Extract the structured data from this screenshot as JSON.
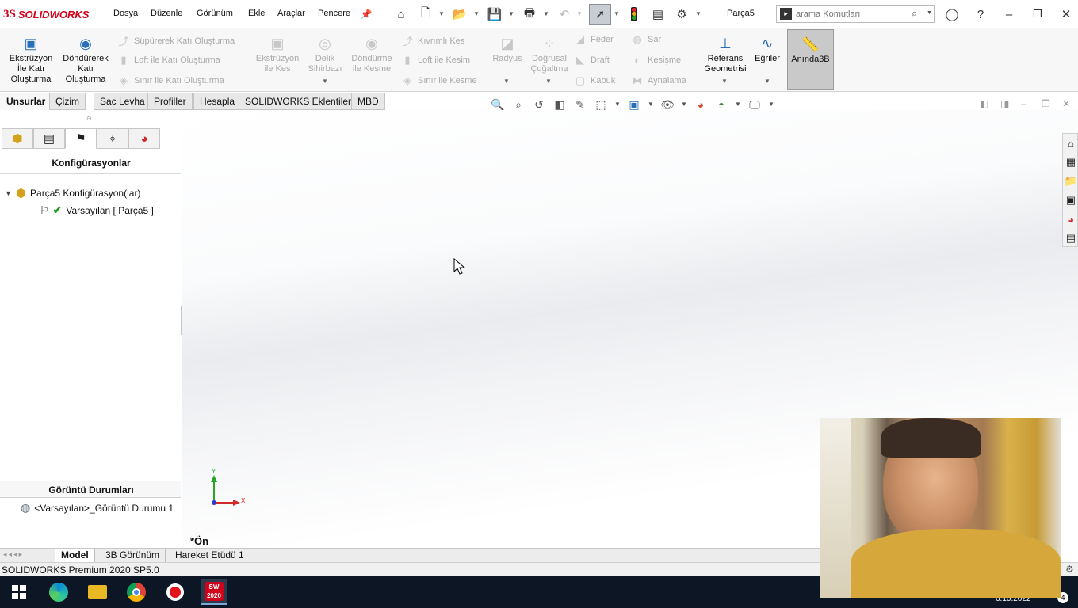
{
  "app": {
    "brand_prefix": "3S",
    "brand": "SOLIDWORKS",
    "doc_title": "Parça5"
  },
  "menu": [
    "Dosya",
    "Düzenle",
    "Görünüm",
    "Ekle",
    "Araçlar",
    "Pencere"
  ],
  "search": {
    "placeholder": "arama Komutları"
  },
  "ribbon": {
    "big_buttons": [
      {
        "label": "Ekstrüzyon İle Katı Oluşturma",
        "icon": "extrude-boss-icon",
        "enabled": true
      },
      {
        "label": "Döndürerek Katı Oluşturma",
        "icon": "revolve-boss-icon",
        "enabled": true
      },
      {
        "label": "Ekstrüzyon ile Kes",
        "icon": "extruded-cut-icon",
        "enabled": false
      },
      {
        "label": "Delik Sihirbazı",
        "icon": "hole-wizard-icon",
        "enabled": false
      },
      {
        "label": "Döndürme ile Kesme",
        "icon": "revolved-cut-icon",
        "enabled": false
      },
      {
        "label": "Radyus",
        "icon": "fillet-icon",
        "enabled": false
      },
      {
        "label": "Doğrusal Çoğaltma",
        "icon": "linear-pattern-icon",
        "enabled": false
      },
      {
        "label": "Referans Geometrisi",
        "icon": "reference-geometry-icon",
        "enabled": true
      },
      {
        "label": "Eğriler",
        "icon": "curves-icon",
        "enabled": true
      },
      {
        "label": "Anında3B",
        "icon": "instant3d-icon",
        "enabled": true
      }
    ],
    "small_buttons": [
      {
        "label": "Süpürerek Katı Oluşturma",
        "icon": "sweep-icon"
      },
      {
        "label": "Loft ile Katı Oluşturma",
        "icon": "loft-icon"
      },
      {
        "label": "Sınır ile Katı Oluşturma",
        "icon": "boundary-boss-icon"
      },
      {
        "label": "Kıvrımlı Kes",
        "icon": "swept-cut-icon"
      },
      {
        "label": "Loft ile Kesim",
        "icon": "lofted-cut-icon"
      },
      {
        "label": "Sınır ile Kesme",
        "icon": "boundary-cut-icon"
      },
      {
        "label": "Feder",
        "icon": "rib-icon"
      },
      {
        "label": "Draft",
        "icon": "draft-icon"
      },
      {
        "label": "Kabuk",
        "icon": "shell-icon"
      },
      {
        "label": "Sar",
        "icon": "wrap-icon"
      },
      {
        "label": "Kesişme",
        "icon": "intersect-icon"
      },
      {
        "label": "Aynalama",
        "icon": "mirror-icon"
      }
    ]
  },
  "command_tabs": [
    {
      "label": "Unsurlar",
      "active": true
    },
    {
      "label": "Çizim",
      "active": false
    },
    {
      "label": "Sac Levha",
      "active": false
    },
    {
      "label": "Profiller",
      "active": false
    },
    {
      "label": "Hesapla",
      "active": false
    },
    {
      "label": "SOLIDWORKS Eklentileri",
      "active": false
    },
    {
      "label": "MBD",
      "active": false
    }
  ],
  "left_panel": {
    "heading": "Konfigürasyonlar",
    "tree_root": "Parça5 Konfigürasyon(lar)",
    "tree_child": "Varsayılan [ Parça5 ]",
    "display_states_heading": "Görüntü Durumları",
    "display_state_item": "<Varsayılan>_Görüntü Durumu 1"
  },
  "viewport": {
    "view_label": "*Ön",
    "axis_x": "X",
    "axis_y": "Y"
  },
  "bottom_tabs": [
    {
      "label": "Model",
      "active": true
    },
    {
      "label": "3B Görünüm",
      "active": false
    },
    {
      "label": "Hareket Etüdü 1",
      "active": false
    }
  ],
  "status": {
    "text": "SOLIDWORKS Premium 2020 SP5.0"
  },
  "taskbar": {
    "date": "6.10.2022",
    "notification_count": "4",
    "sw_badge": "2020"
  }
}
